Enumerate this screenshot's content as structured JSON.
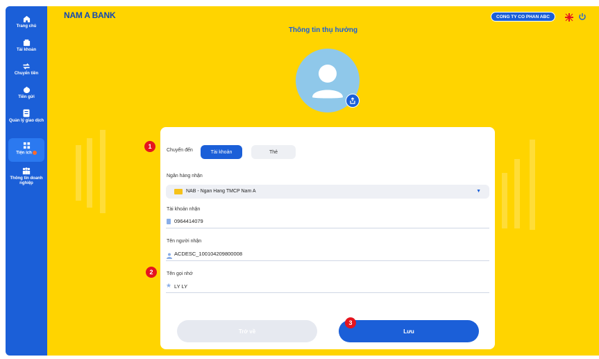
{
  "sidebar": {
    "items": [
      {
        "label": "Trang chủ",
        "icon": "home-icon"
      },
      {
        "label": "Tài khoản",
        "icon": "wallet-icon"
      },
      {
        "label": "Chuyển tiền",
        "icon": "transfer-icon"
      },
      {
        "label": "Tiền gửi",
        "icon": "savings-icon"
      },
      {
        "label": "Quản lý giao dịch",
        "icon": "transactions-icon"
      },
      {
        "label": "Tiện ích",
        "icon": "utilities-icon",
        "active": true
      },
      {
        "label": "Thông tin doanh nghiệp",
        "icon": "business-icon"
      }
    ]
  },
  "header": {
    "logo": "NAM A BANK",
    "company": "CONG TY CO PHAN ABC",
    "title": "Thông tin thụ hưởng"
  },
  "form": {
    "transfer_to_label": "Chuyển đến",
    "tabs": [
      "Tài khoản",
      "Thẻ"
    ],
    "bank_label": "Ngân hàng nhận",
    "bank_value": "NAB - Ngan Hang TMCP Nam A",
    "account_label": "Tài khoản nhận",
    "account_value": "0964414079",
    "receiver_label": "Tên người nhận",
    "receiver_value": "ACDESC_100104209800008",
    "nickname_label": "Tên gọi nhớ",
    "nickname_value": "LY LY",
    "back_label": "Trở về",
    "save_label": "Lưu"
  },
  "markers": [
    "1",
    "2",
    "3"
  ],
  "colors": {
    "brand_blue": "#1b5fd8",
    "background_yellow": "#ffd400",
    "marker_red": "#e5141e"
  }
}
